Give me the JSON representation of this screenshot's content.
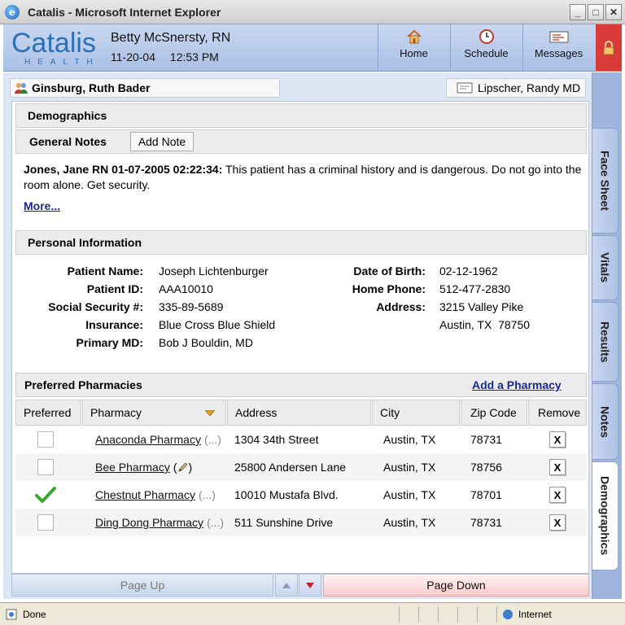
{
  "window": {
    "title": "Catalis - Microsoft Internet Explorer"
  },
  "header": {
    "logo_word": "Catalis",
    "logo_sub": "HEALTH",
    "user_name": "Betty McSnersty, RN",
    "date": "11-20-04",
    "time": "12:53 PM",
    "nav": {
      "home": "Home",
      "schedule": "Schedule",
      "messages": "Messages"
    }
  },
  "patient": {
    "name": "Ginsburg, Ruth Bader",
    "attending": "Lipscher, Randy MD"
  },
  "sections": {
    "demographics": "Demographics",
    "general_notes": "General Notes",
    "add_note": "Add Note",
    "personal_info": "Personal Information",
    "preferred_pharmacies": "Preferred Pharmacies",
    "add_pharmacy": "Add a Pharmacy"
  },
  "note": {
    "author": "Jones, Jane RN 01-07-2005 02:22:34:",
    "text": " This patient has a criminal history and is dangerous. Do not go into the room alone. Get security.",
    "more": "More..."
  },
  "personal": {
    "labels": {
      "patient_name": "Patient Name:",
      "patient_id": "Patient ID:",
      "ssn": "Social Security #:",
      "insurance": "Insurance:",
      "primary_md": "Primary MD:",
      "dob": "Date of Birth:",
      "home_phone": "Home Phone:",
      "address": "Address:"
    },
    "values": {
      "patient_name": "Joseph Lichtenburger",
      "patient_id": "AAA10010",
      "ssn": "335-89-5689",
      "insurance": "Blue Cross Blue Shield",
      "primary_md": "Bob J Bouldin, MD",
      "dob": "02-12-1962",
      "home_phone": "512-477-2830",
      "address_line1": "3215 Valley Pike",
      "address_line2": "Austin, TX  78750"
    }
  },
  "pharmacy_table": {
    "columns": [
      "Preferred",
      "Pharmacy",
      "Address",
      "City",
      "Zip Code",
      "Remove"
    ],
    "rows": [
      {
        "preferred": false,
        "name": "Anaconda Pharmacy",
        "suffix": "(...)",
        "address": "1304 34th Street",
        "city": "Austin, TX",
        "zip": "78731",
        "remove": "X"
      },
      {
        "preferred": false,
        "name": "Bee Pharmacy",
        "suffix": "(",
        "suffix_end": ")",
        "address": "25800 Andersen Lane",
        "city": "Austin, TX",
        "zip": "78756",
        "remove": "X"
      },
      {
        "preferred": true,
        "name": "Chestnut Pharmacy",
        "suffix": "(...)",
        "address": "10010 Mustafa Blvd.",
        "city": "Austin, TX",
        "zip": "78701",
        "remove": "X"
      },
      {
        "preferred": false,
        "name": "Ding Dong Pharmacy",
        "suffix": "(...)",
        "address": "511 Sunshine Drive",
        "city": "Austin, TX",
        "zip": "78731",
        "remove": "X"
      }
    ]
  },
  "pager": {
    "page_up": "Page Up",
    "page_down": "Page Down"
  },
  "side_tabs": [
    "Face Sheet",
    "Vitals",
    "Results",
    "Notes",
    "Demographics"
  ],
  "statusbar": {
    "status": "Done",
    "zone": "Internet"
  },
  "colors": {
    "accent": "#2f6fb4",
    "lock": "#d93a3a",
    "link": "#1a2a8c",
    "check": "#3aa832"
  }
}
